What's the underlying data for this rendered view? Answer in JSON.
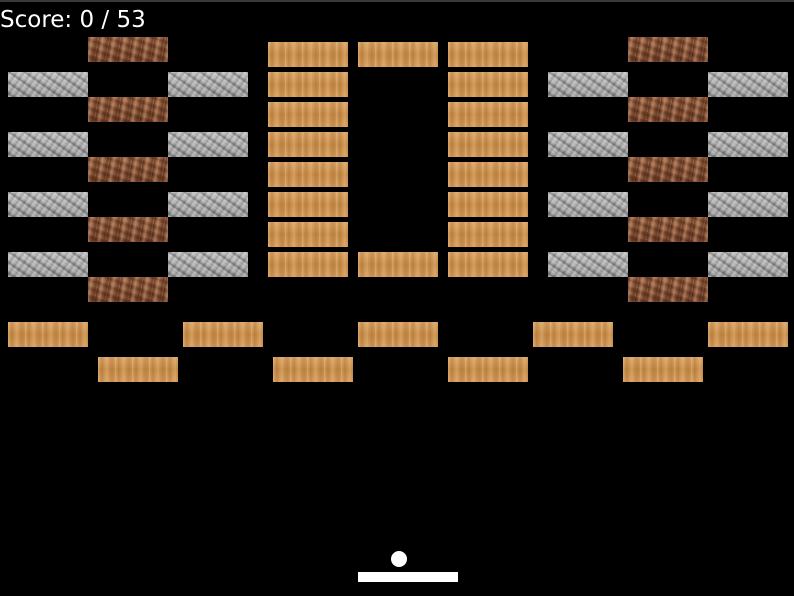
{
  "score": {
    "label": "Score: 0 / 53",
    "current": 0,
    "total": 53
  },
  "colors": {
    "background": "#000000",
    "wood": "#c9904e",
    "stone": "#9c9c9c",
    "bark": "#8c5a3c",
    "ball": "#ffffff",
    "paddle": "#ffffff"
  },
  "brick_types": [
    "wood",
    "stone",
    "bark"
  ],
  "brick_count_visible": 53
}
